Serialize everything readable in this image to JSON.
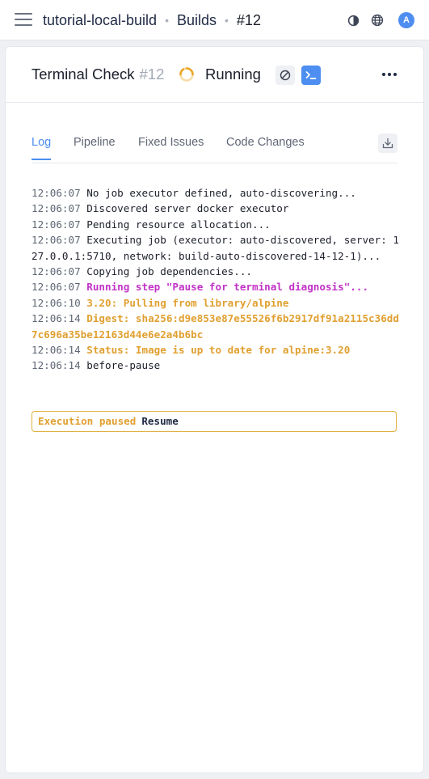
{
  "topbar": {
    "breadcrumbs": [
      "tutorial-local-build",
      "Builds",
      "#12"
    ],
    "separator": "•",
    "avatar_letter": "A",
    "icons": [
      "theme-toggle-icon",
      "globe-icon"
    ]
  },
  "build": {
    "job_name": "Terminal Check",
    "number": "#12",
    "status": "Running"
  },
  "tabs": [
    "Log",
    "Pipeline",
    "Fixed Issues",
    "Code Changes"
  ],
  "log": [
    {
      "ts": "12:06:07",
      "msg": "No job executor defined, auto-discovering...",
      "style": ""
    },
    {
      "ts": "12:06:07",
      "msg": "Discovered server docker executor",
      "style": ""
    },
    {
      "ts": "12:06:07",
      "msg": "Pending resource allocation...",
      "style": ""
    },
    {
      "ts": "12:06:07",
      "msg": "Executing job (executor: auto-discovered, server: 127.0.0.1:5710, network: build-auto-discovered-14-12-1)...",
      "style": ""
    },
    {
      "ts": "12:06:07",
      "msg": "Copying job dependencies...",
      "style": ""
    },
    {
      "ts": "12:06:07",
      "msg": "Running step \"Pause for terminal diagnosis\"...",
      "style": "purple"
    },
    {
      "ts": "12:06:10",
      "msg": "3.20: Pulling from library/alpine",
      "style": "orange"
    },
    {
      "ts": "12:06:14",
      "msg": "Digest: sha256:d9e853e87e55526f6b2917df91a2115c36dd7c696a35be12163d44e6e2a4b6bc",
      "style": "orange"
    },
    {
      "ts": "12:06:14",
      "msg": "Status: Image is up to date for alpine:3.20",
      "style": "orange"
    },
    {
      "ts": "12:06:14",
      "msg": "before-pause",
      "style": ""
    }
  ],
  "paused": {
    "label": "Execution paused",
    "resume_label": "Resume"
  },
  "colors": {
    "accent": "#4d8ef0",
    "purple": "#c232c8",
    "orange": "#e0a030"
  }
}
